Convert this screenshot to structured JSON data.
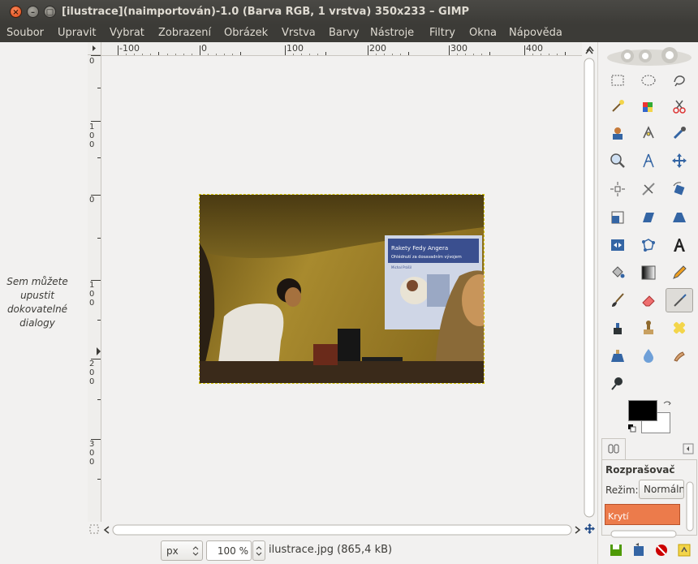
{
  "window": {
    "title": "[ilustrace](naimportován)-1.0 (Barva RGB, 1 vrstva) 350x233 – GIMP",
    "close_glyph": "×",
    "minimize_glyph": "–",
    "maximize_glyph": "□"
  },
  "menubar": {
    "items": [
      "Soubor",
      "Upravit",
      "Vybrat",
      "Zobrazení",
      "Obrázek",
      "Vrstva",
      "Barvy",
      "Nástroje",
      "Filtry",
      "Okna",
      "Nápověda"
    ]
  },
  "left_dock": {
    "hint_lines": [
      "Sem můžete",
      "upustit",
      "dokovatelné",
      "dialogy"
    ]
  },
  "rulers": {
    "horizontal_labels": [
      "-100",
      "0",
      "100",
      "200",
      "300",
      "400"
    ],
    "vertical_labels": [
      [
        "0"
      ],
      [
        "1",
        "0",
        "0"
      ],
      [
        "0"
      ],
      [
        "1",
        "0",
        "0"
      ],
      [
        "2",
        "0",
        "0"
      ],
      [
        "3",
        "0",
        "0"
      ]
    ]
  },
  "image": {
    "slide_title": "Rakety Fedy Angera",
    "slide_subtitle": "Ohlédnutí za dosavadním vývojem",
    "slide_author": "Michal Prášil"
  },
  "statusbar": {
    "unit": "px",
    "zoom": "100 %",
    "file_info": "ilustrace.jpg (865,4 kB)"
  },
  "toolbox": {
    "tool_icons": [
      "rect-select-icon",
      "ellipse-select-icon",
      "free-select-icon",
      "fuzzy-select-icon",
      "select-by-color-icon",
      "scissors-select-icon",
      "foreground-select-icon",
      "paths-icon",
      "color-picker-icon",
      "zoom-icon",
      "measure-icon",
      "move-icon",
      "align-icon",
      "crop-icon",
      "rotate-icon",
      "scale-icon",
      "shear-icon",
      "perspective-icon",
      "flip-icon",
      "cage-transform-icon",
      "text-icon",
      "bucket-fill-icon",
      "blend-icon",
      "pencil-icon",
      "paintbrush-icon",
      "eraser-icon",
      "airbrush-icon",
      "ink-icon",
      "clone-icon",
      "heal-icon",
      "perspective-clone-icon",
      "blur-sharpen-icon",
      "smudge-icon",
      "dodge-burn-icon"
    ],
    "active_tool": "airbrush-icon",
    "fg_color": "#000000",
    "bg_color": "#ffffff",
    "options_title": "Rozprašovač",
    "mode_label": "Režim:",
    "mode_value": "Normální",
    "opacity_label": "Krytí",
    "opacity_color": "#ec7b4b"
  }
}
